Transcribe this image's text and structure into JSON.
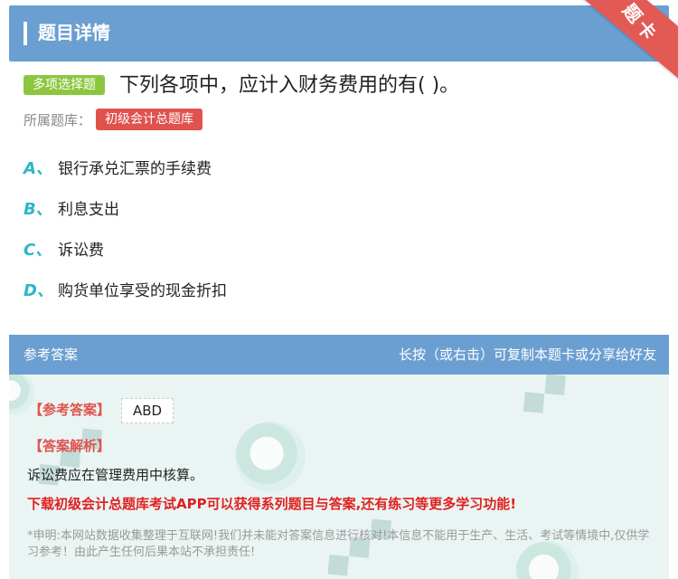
{
  "header": {
    "title": "题目详情",
    "ribbon_label": "题卡"
  },
  "question": {
    "type_badge": "多项选择题",
    "text": "下列各项中，应计入财务费用的有( )。",
    "bank_label": "所属题库：",
    "bank_name": "初级会计总题库"
  },
  "options": [
    {
      "letter": "A、",
      "text": "银行承兑汇票的手续费"
    },
    {
      "letter": "B、",
      "text": "利息支出"
    },
    {
      "letter": "C、",
      "text": "诉讼费"
    },
    {
      "letter": "D、",
      "text": "购货单位享受的现金折扣"
    }
  ],
  "answer_panel": {
    "header_left": "参考答案",
    "header_right": "长按（或右击）可复制本题卡或分享给好友",
    "ref_answer_label": "【参考答案】",
    "ref_answer_value": "ABD",
    "analysis_label": "【答案解析】",
    "analysis_text": "诉讼费应在管理费用中核算。",
    "promo_text": "下载初级会计总题库考试APP可以获得系列题目与答案,还有练习等更多学习功能!",
    "disclaimer": "*申明:本网站数据收集整理于互联网!我们并未能对答案信息进行核对!本信息不能用于生产、生活、考试等情境中,仅供学习参考！由此产生任何后果本站不承担责任!"
  },
  "colors": {
    "header_blue": "#6b9fd1",
    "badge_green": "#8cc63f",
    "tag_red": "#e0524d",
    "option_teal": "#2bb8c8",
    "promo_red": "#e02020"
  }
}
